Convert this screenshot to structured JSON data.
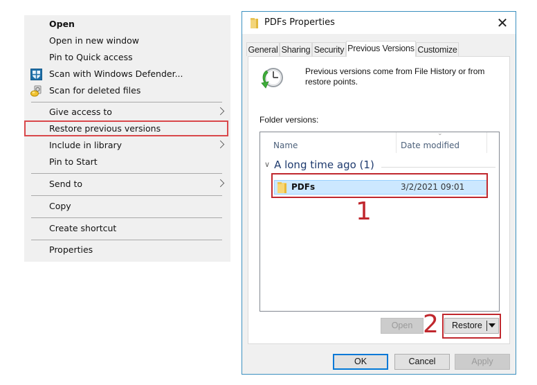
{
  "context_menu": {
    "items": [
      {
        "label": "Open",
        "bold": true,
        "icon": null,
        "submenu": false
      },
      {
        "label": "Open in new window",
        "bold": false,
        "icon": null,
        "submenu": false
      },
      {
        "label": "Pin to Quick access",
        "bold": false,
        "icon": null,
        "submenu": false
      },
      {
        "label": "Scan with Windows Defender...",
        "bold": false,
        "icon": "windows-defender-icon",
        "submenu": false
      },
      {
        "label": "Scan for deleted files",
        "bold": false,
        "icon": "scan-deleted-files-icon",
        "submenu": false
      },
      {
        "label": "Give access to",
        "bold": false,
        "icon": null,
        "submenu": true
      },
      {
        "label": "Restore previous versions",
        "bold": false,
        "icon": null,
        "submenu": false,
        "highlighted": true
      },
      {
        "label": "Include in library",
        "bold": false,
        "icon": null,
        "submenu": true
      },
      {
        "label": "Pin to Start",
        "bold": false,
        "icon": null,
        "submenu": false
      },
      {
        "label": "Send to",
        "bold": false,
        "icon": null,
        "submenu": true
      },
      {
        "label": "Copy",
        "bold": false,
        "icon": null,
        "submenu": false
      },
      {
        "label": "Create shortcut",
        "bold": false,
        "icon": null,
        "submenu": false
      },
      {
        "label": "Properties",
        "bold": false,
        "icon": null,
        "submenu": false
      }
    ]
  },
  "dialog": {
    "title": "PDFs Properties",
    "title_icon": "folder-icon",
    "close_glyph": "✕",
    "tabs": [
      {
        "label": "General",
        "active": false
      },
      {
        "label": "Sharing",
        "active": false
      },
      {
        "label": "Security",
        "active": false
      },
      {
        "label": "Previous Versions",
        "active": true
      },
      {
        "label": "Customize",
        "active": false
      }
    ],
    "description": "Previous versions come from File History or from restore points.",
    "folder_versions_label": "Folder versions:",
    "columns": {
      "name": "Name",
      "date_modified": "Date modified"
    },
    "group": {
      "label": "A long time ago (1)"
    },
    "versions": [
      {
        "name": "PDFs",
        "date_modified": "3/2/2021 09:01",
        "selected": true
      }
    ],
    "buttons": {
      "open": "Open",
      "restore": "Restore",
      "ok": "OK",
      "cancel": "Cancel",
      "apply": "Apply"
    }
  },
  "annotations": {
    "step1": "1",
    "step2": "2",
    "color": "#c0272d"
  }
}
